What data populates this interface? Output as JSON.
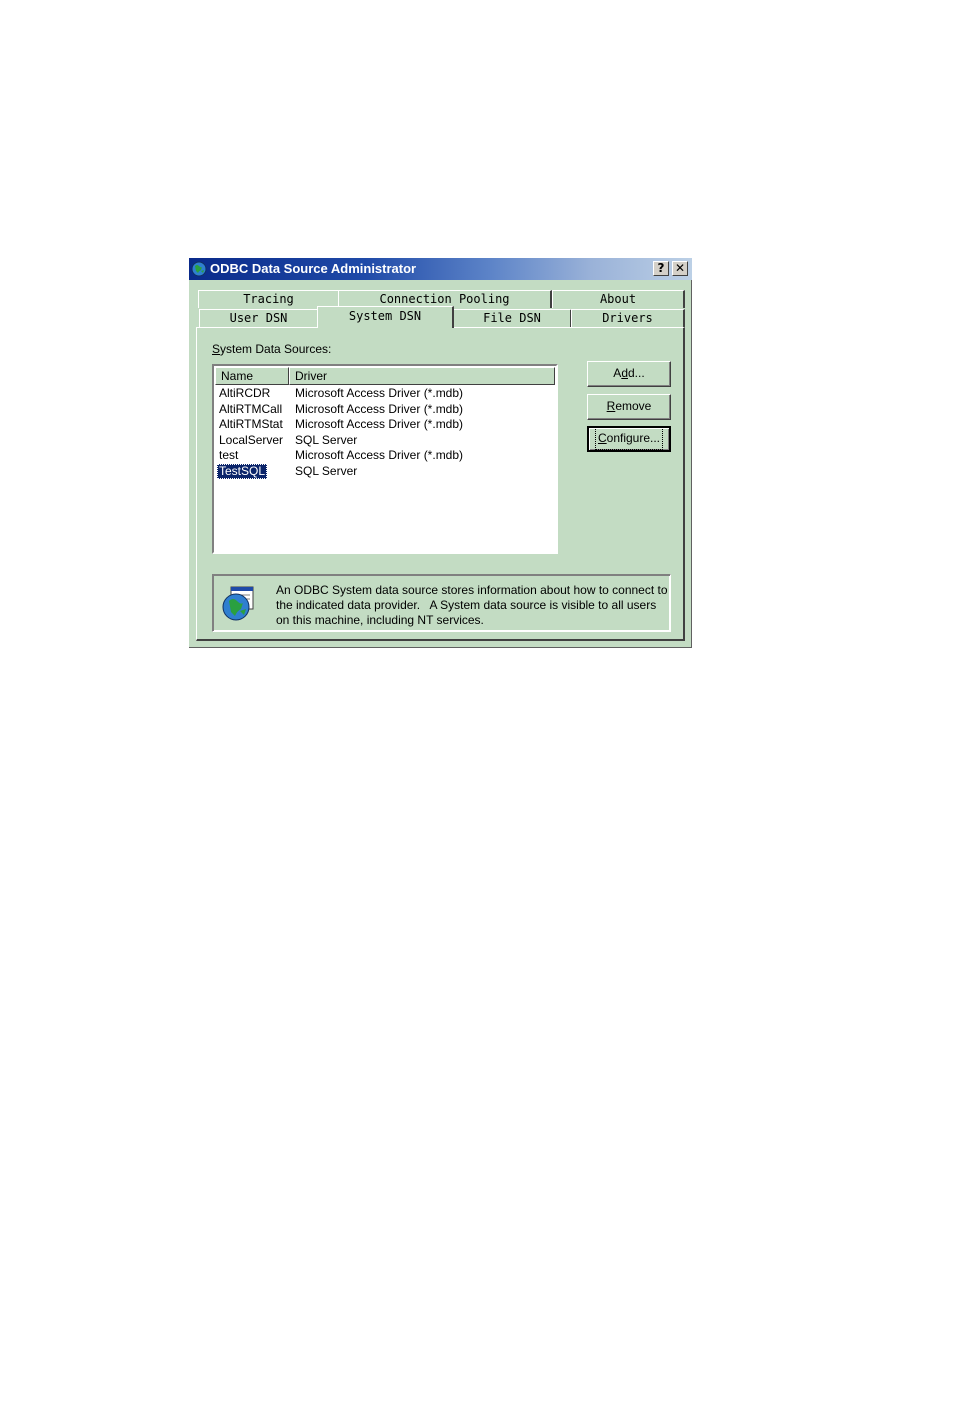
{
  "window": {
    "title": "ODBC Data Source Administrator",
    "help_glyph": "?",
    "close_glyph": "✕"
  },
  "tabs_back": [
    {
      "label": "Tracing"
    },
    {
      "label": "Connection Pooling"
    },
    {
      "label": "About"
    }
  ],
  "tabs_front": [
    {
      "label": "User DSN"
    },
    {
      "label": "System DSN",
      "active": true
    },
    {
      "label": "File DSN"
    },
    {
      "label": "Drivers"
    }
  ],
  "panel": {
    "section_label_mnemonic": "S",
    "section_label_rest": "ystem Data Sources:"
  },
  "list": {
    "columns": [
      "Name",
      "Driver"
    ],
    "rows": [
      {
        "name": "AltiRCDR",
        "driver": "Microsoft Access Driver (*.mdb)"
      },
      {
        "name": "AltiRTMCall",
        "driver": "Microsoft Access Driver (*.mdb)"
      },
      {
        "name": "AltiRTMStat",
        "driver": "Microsoft Access Driver (*.mdb)"
      },
      {
        "name": "LocalServer",
        "driver": "SQL Server"
      },
      {
        "name": "test",
        "driver": "Microsoft Access Driver (*.mdb)"
      },
      {
        "name": "TestSQL",
        "driver": "SQL Server",
        "selected": true
      }
    ]
  },
  "buttons": {
    "add_pre": "A",
    "add_mnemonic": "d",
    "add_post": "d...",
    "remove_mnemonic": "R",
    "remove_post": "emove",
    "configure_mnemonic": "C",
    "configure_post": "onfigure..."
  },
  "info": {
    "line1": "An ODBC System data source stores information about how to connect to",
    "line2": "the indicated data provider.   A System data source is visible to all users",
    "line3": "on this machine, including NT services."
  },
  "icons": {
    "title": "odbc-globe-icon",
    "info": "odbc-info-globe-icon"
  }
}
